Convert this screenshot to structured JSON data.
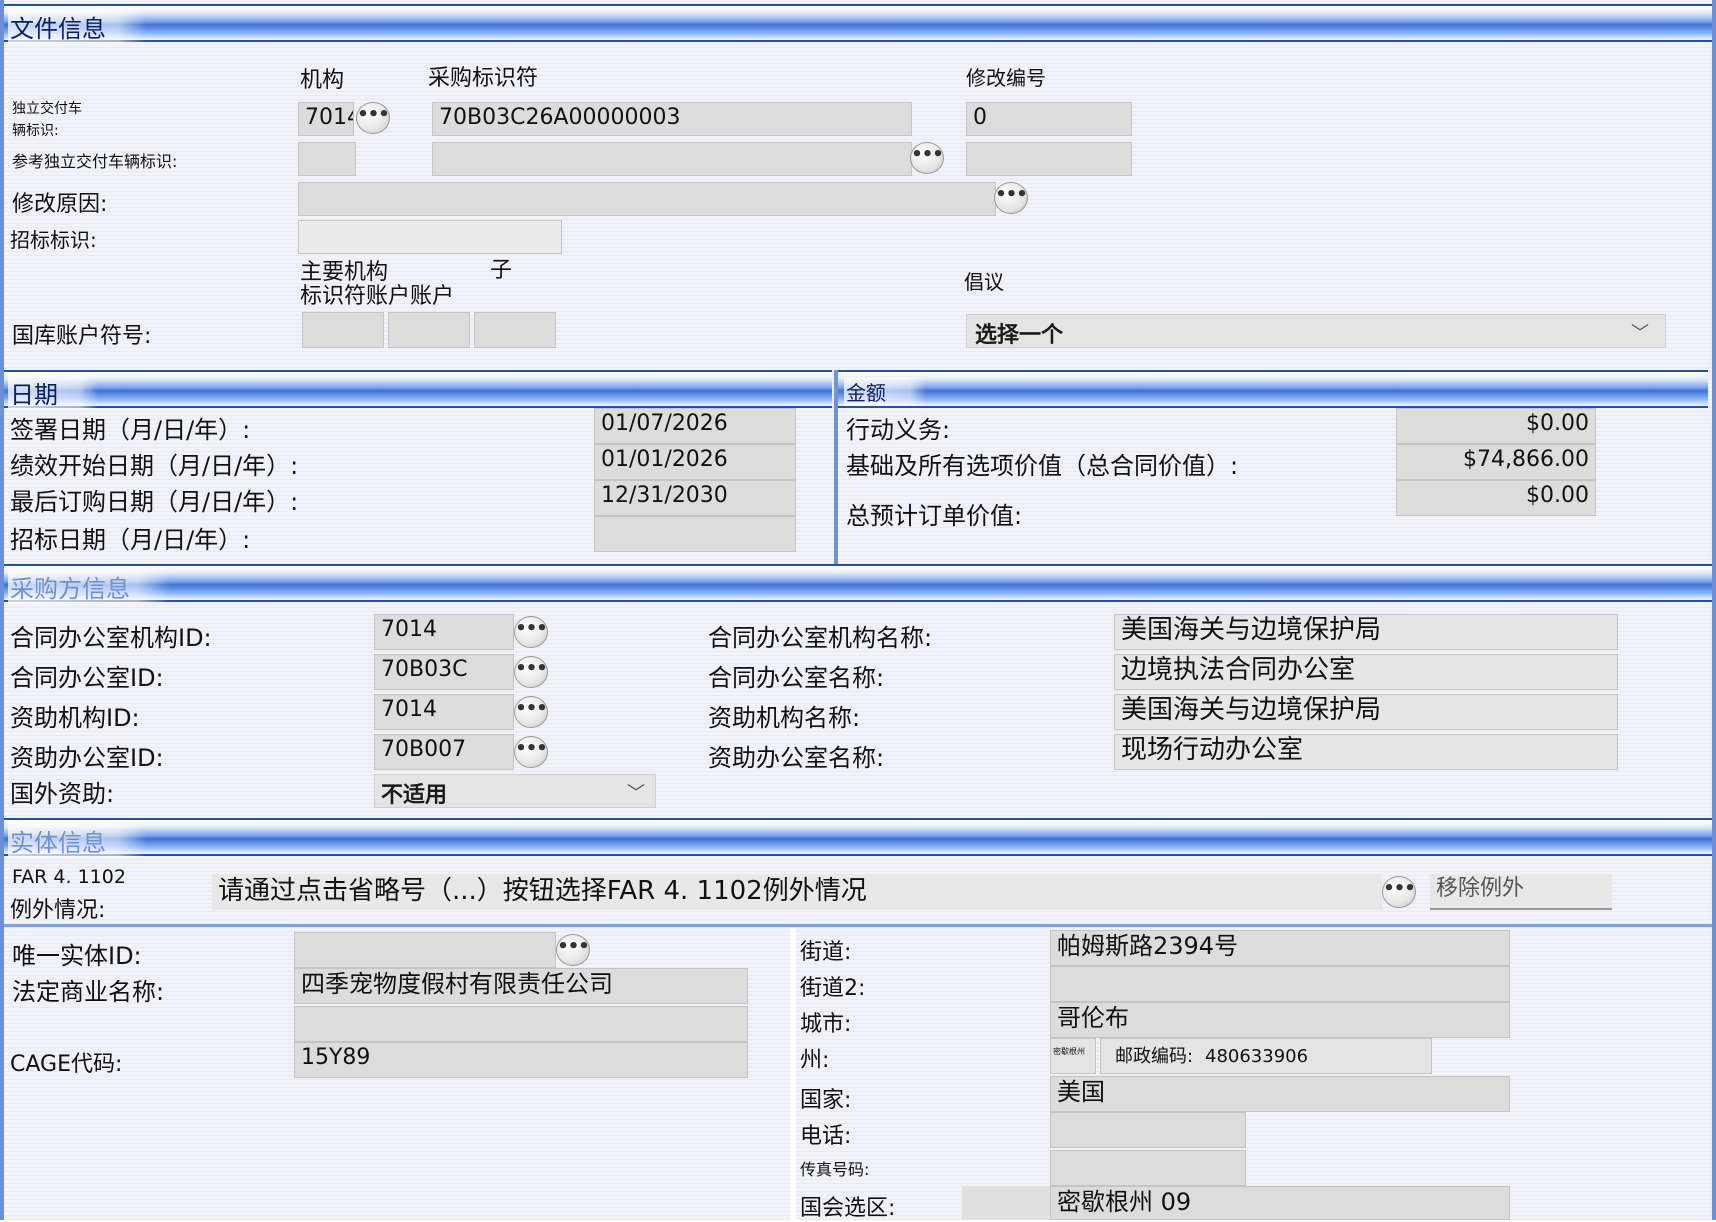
{
  "sections": {
    "file_info": "文件信息",
    "dates": "日期",
    "amounts": "金额",
    "purchaser_info": "采购方信息",
    "entity_info": "实体信息"
  },
  "file_info": {
    "col_agency": "机构",
    "col_proc_id": "采购标识符",
    "col_mod_no": "修改编号",
    "piid_label": "独立交付车辆标识:",
    "piid_agency": "7014",
    "piid_value": "70B03C26A00000003",
    "mod_no": "0",
    "ref_piid_label": "参考独立交付车辆标识:",
    "mod_reason_label": "修改原因:",
    "solicitation_id_label": "招标标识:",
    "tas_head_main": "主要机构",
    "tas_head_sub": "子",
    "tas_head_row2": "标识符账户账户",
    "initiative_label": "倡议",
    "tas_label": "国库账户符号:",
    "initiative_select": "选择一个"
  },
  "dates": {
    "signed_label": "签署日期（月/日/年）:",
    "signed": "01/07/2026",
    "perf_start_label": "绩效开始日期（月/日/年）:",
    "perf_start": "01/01/2026",
    "last_order_label": "最后订购日期（月/日/年）:",
    "last_order": "12/31/2030",
    "solicit_label": "招标日期（月/日/年）:",
    "solicit": ""
  },
  "amounts": {
    "obligation_label": "行动义务:",
    "obligation": "$0.00",
    "base_all_label": "基础及所有选项价值（总合同价值）:",
    "base_all": "$74,866.00",
    "est_order_label": "总预计订单价值:",
    "est_order": "$0.00"
  },
  "purchaser": {
    "co_agency_id_label": "合同办公室机构ID:",
    "co_agency_id": "7014",
    "co_id_label": "合同办公室ID:",
    "co_id": "70B03C",
    "funding_agency_id_label": "资助机构ID:",
    "funding_agency_id": "7014",
    "funding_office_id_label": "资助办公室ID:",
    "funding_office_id": "70B007",
    "foreign_funding_label": "国外资助:",
    "foreign_funding": "不适用",
    "co_agency_name_label": "合同办公室机构名称:",
    "co_agency_name": "美国海关与边境保护局",
    "co_name_label": "合同办公室名称:",
    "co_name": "边境执法合同办公室",
    "funding_agency_name_label": "资助机构名称:",
    "funding_agency_name": "美国海关与边境保护局",
    "funding_office_name_label": "资助办公室名称:",
    "funding_office_name": "现场行动办公室"
  },
  "entity": {
    "far_label_1": "FAR 4. 1102",
    "far_label_2": "例外情况:",
    "far_prompt": "请通过点击省略号（...）按钮选择FAR 4. 1102例外情况",
    "remove_exception": "移除例外",
    "uei_label": "唯一实体ID:",
    "legal_name_label": "法定商业名称:",
    "legal_name": "四季宠物度假村有限责任公司",
    "cage_label": "CAGE代码:",
    "cage": "15Y89",
    "street_label": "街道:",
    "street": "帕姆斯路2394号",
    "street2_label": "街道2:",
    "city_label": "城市:",
    "city": "哥伦布",
    "state_label": "州:",
    "state_value": "密歇根州",
    "zip_label": "邮政编码:",
    "zip": "480633906",
    "country_label": "国家:",
    "country": "美国",
    "phone_label": "电话:",
    "fax_label": "传真号码:",
    "district_label": "国会选区:",
    "district": "密歇根州 09"
  },
  "ellipsis": "•••"
}
